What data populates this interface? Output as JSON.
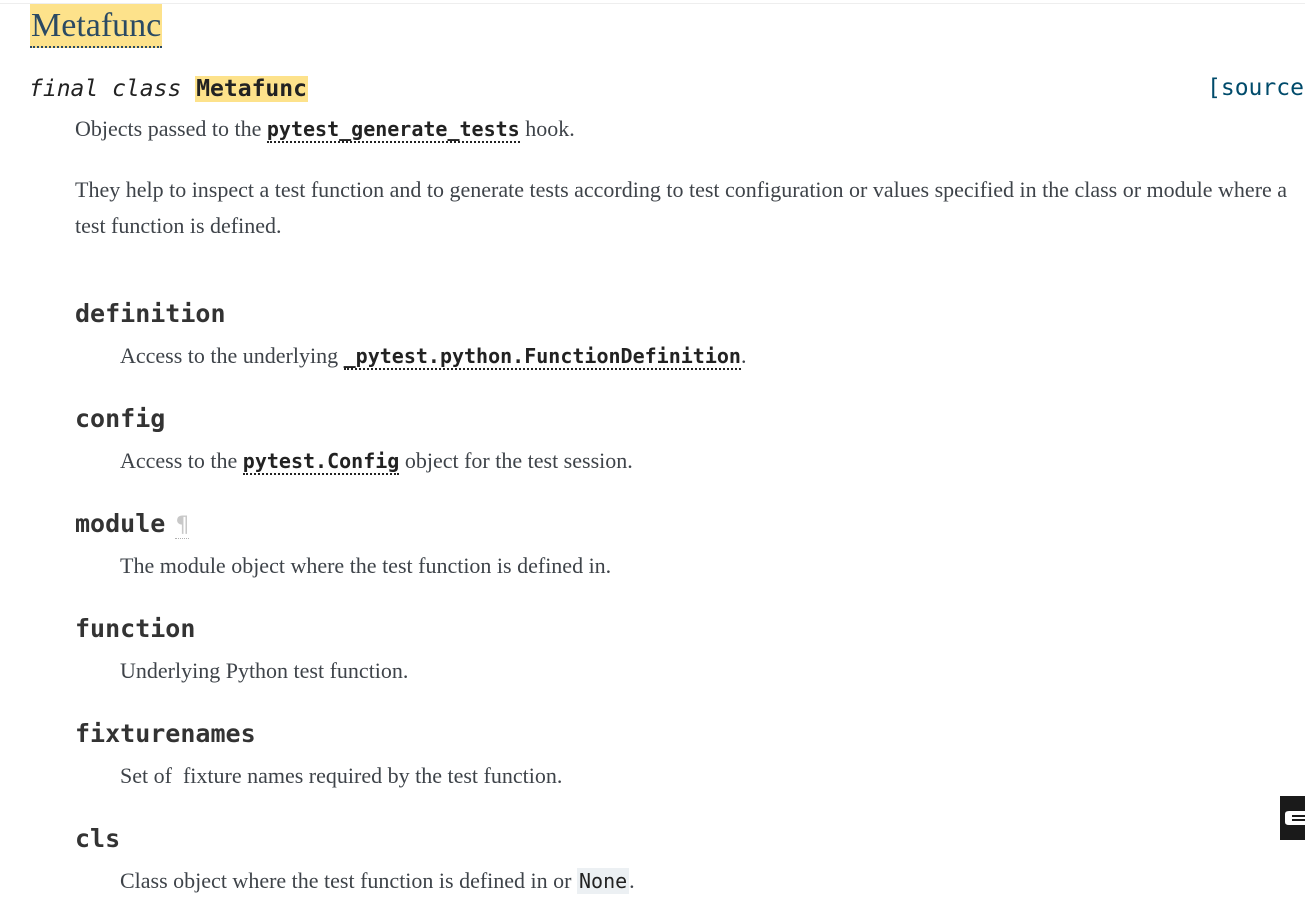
{
  "heading": "Metafunc",
  "signature": {
    "prefix": "final class",
    "name": "Metafunc",
    "source_link": "[source"
  },
  "intro": {
    "line1_before": "Objects passed to the",
    "line1_code": "pytest_generate_tests",
    "line1_after": "hook.",
    "paragraph2": "They help to inspect a test function and to generate tests according to test configuration or values specified in the class or module where a test function is defined."
  },
  "attributes": [
    {
      "name": "definition",
      "desc_before": "Access to the underlying",
      "desc_code": "_pytest.python.FunctionDefinition",
      "desc_after": "."
    },
    {
      "name": "config",
      "desc_before": "Access to the",
      "desc_code": "pytest.Config",
      "desc_after": "object for the test session."
    },
    {
      "name": "module",
      "pilcrow": "¶",
      "desc": "The module object where the test function is defined in."
    },
    {
      "name": "function",
      "desc": "Underlying Python test function."
    },
    {
      "name": "fixturenames",
      "desc": "Set of  fixture names required by the test function."
    },
    {
      "name": "cls",
      "desc_before": "Class object where the test function is defined in or",
      "desc_code": "None",
      "desc_after": "."
    }
  ],
  "floating_button": {
    "icon": "book-icon",
    "color": "#1a1a1a"
  },
  "colors": {
    "highlight": "#fde28b",
    "link": "#004b6b",
    "text": "#3e4349"
  }
}
